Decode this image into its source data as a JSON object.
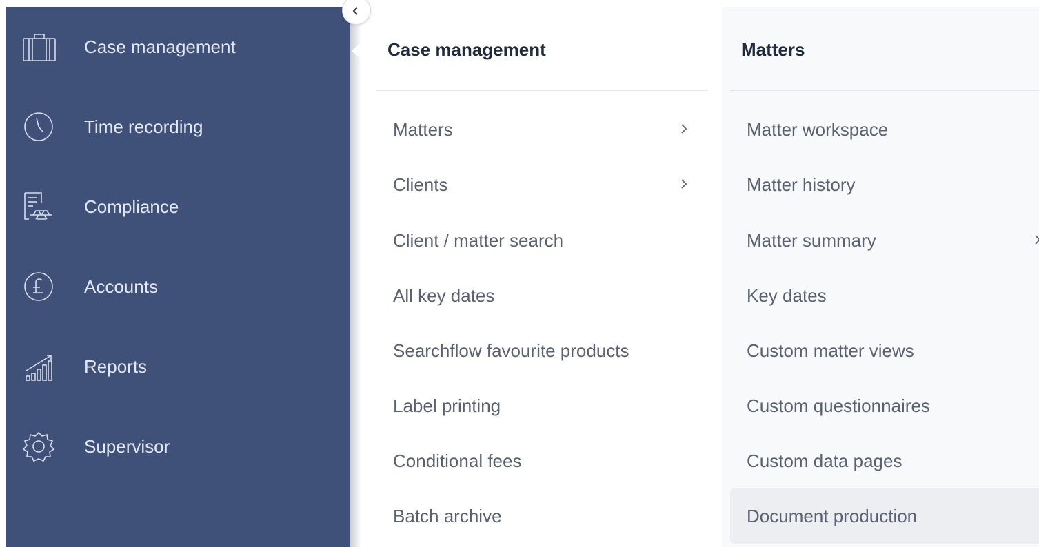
{
  "sidebar": {
    "items": [
      {
        "label": "Case management",
        "icon": "briefcase-icon"
      },
      {
        "label": "Time recording",
        "icon": "clock-icon"
      },
      {
        "label": "Compliance",
        "icon": "compliance-document-icon"
      },
      {
        "label": "Accounts",
        "icon": "pound-currency-icon"
      },
      {
        "label": "Reports",
        "icon": "growth-chart-icon"
      },
      {
        "label": "Supervisor",
        "icon": "gear-icon"
      }
    ]
  },
  "menu_column": {
    "header": "Case management",
    "items": [
      {
        "label": "Matters",
        "has_submenu": true
      },
      {
        "label": "Clients",
        "has_submenu": true
      },
      {
        "label": "Client / matter search",
        "has_submenu": false
      },
      {
        "label": "All key dates",
        "has_submenu": false
      },
      {
        "label": "Searchflow favourite products",
        "has_submenu": false
      },
      {
        "label": "Label printing",
        "has_submenu": false
      },
      {
        "label": "Conditional fees",
        "has_submenu": false
      },
      {
        "label": "Batch archive",
        "has_submenu": false
      }
    ]
  },
  "submenu_column": {
    "header": "Matters",
    "items": [
      {
        "label": "Matter workspace",
        "has_submenu": false
      },
      {
        "label": "Matter history",
        "has_submenu": false
      },
      {
        "label": "Matter summary",
        "has_submenu": true
      },
      {
        "label": "Key dates",
        "has_submenu": false
      },
      {
        "label": "Custom matter views",
        "has_submenu": false
      },
      {
        "label": "Custom questionnaires",
        "has_submenu": false
      },
      {
        "label": "Custom data pages",
        "has_submenu": false
      },
      {
        "label": "Document production",
        "has_submenu": false,
        "selected": true
      }
    ]
  },
  "colors": {
    "sidebar_bg": "#3f5178",
    "sidebar_text": "#e2e7f1",
    "header_text": "#1f2a3d",
    "item_text": "#5a6272",
    "submenu_bg": "#f8f9fb",
    "selected_bg": "#eceef2"
  }
}
